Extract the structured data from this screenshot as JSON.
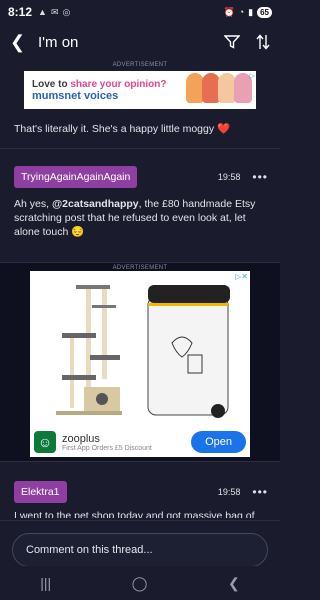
{
  "status_bar": {
    "time": "8:12",
    "battery": "65"
  },
  "header": {
    "title": "I'm on"
  },
  "ad_top": {
    "label": "ADVERTISEMENT",
    "line1_pre": "Love to ",
    "line1_highlight": "share your opinion?",
    "line2": "mumsnet voices"
  },
  "previous_post": {
    "text": "That's literally it. She's a happy little moggy",
    "emoji": "❤️"
  },
  "posts": [
    {
      "username": "TryingAgainAgainAgain",
      "time": "19:58",
      "body_pre": "Ah yes, ",
      "body_mention": "@2catsandhappy",
      "body_post": ", the £80 handmade Etsy scratching post that he refused to even look at, let alone touch",
      "emoji": "😔"
    },
    {
      "username": "Elektra1",
      "time": "19:58",
      "body_partial": "I went to the pet shop today and got massive bag of"
    }
  ],
  "ad_middle": {
    "label": "ADVERTISEMENT",
    "brand": "zooplus",
    "tagline": "First App Orders £5 Discount",
    "cta": "Open"
  },
  "comment": {
    "placeholder": "Comment on this thread..."
  },
  "icons": {
    "back": "back-arrow-icon",
    "filter": "filter-icon",
    "sort": "sort-icon",
    "more": "more-options-icon"
  },
  "colors": {
    "background": "#1a1c2e",
    "username_badge": "#8e3fa1",
    "cta": "#1a73e8"
  }
}
